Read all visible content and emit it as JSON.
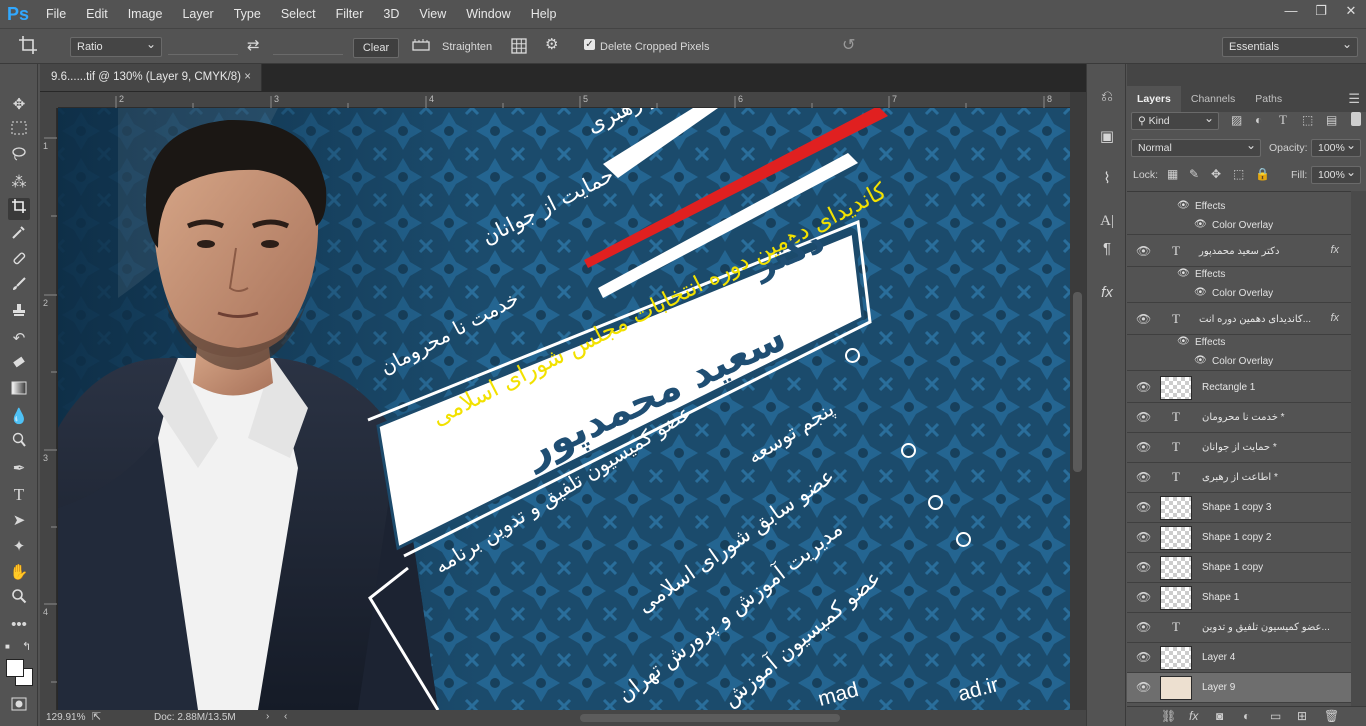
{
  "app": {
    "logo": "Ps"
  },
  "menu": [
    "File",
    "Edit",
    "Image",
    "Layer",
    "Type",
    "Select",
    "Filter",
    "3D",
    "View",
    "Window",
    "Help"
  ],
  "window_controls": {
    "minimize": "—",
    "restore": "❐",
    "close": "✕"
  },
  "options": {
    "ratio": "Ratio",
    "clear": "Clear",
    "straighten": "Straighten",
    "delete_cropped": "Delete Cropped Pixels",
    "workspace": "Essentials",
    "swap_icon": "⇄",
    "reset_icon": "↺"
  },
  "document": {
    "tab_title": "9.6......tif @ 130% (Layer 9, CMYK/8)",
    "close": "×",
    "ruler_h": [
      "2",
      "3",
      "4",
      "5",
      "6",
      "7",
      "8"
    ],
    "ruler_v": [
      "1",
      "2",
      "3",
      "4"
    ],
    "zoom": "129.91%",
    "doc_size": "Doc: 2.88M/13.5M"
  },
  "canvas_text": {
    "line1": "اطاعت از رهبری",
    "line2": "حمایت از جوانان",
    "line3": "خدمت نا محرومان",
    "candidate": "کاندیدای دهمین دوره انتخابات مجلس شورای اسلامی",
    "name_title": "دکتر",
    "name": "سعید محمدپور",
    "b1": "عضو کمیسیون تلفیق و تدوین برنامه",
    "b1b": "پنجم توسعه",
    "b2": "عضو سابق شورای اسلامی",
    "b3": "مدیریت آموزش و پرورش تهران",
    "b4": "عضو کمیسیون آموزش",
    "footer1": "mad",
    "footer2": "ad.ir"
  },
  "panel": {
    "tabs": [
      "Layers",
      "Channels",
      "Paths"
    ],
    "kind": "Kind",
    "blend": "Normal",
    "opacity_label": "Opacity:",
    "opacity": "100%",
    "lock_label": "Lock:",
    "fill_label": "Fill:",
    "fill": "100%"
  },
  "layers": [
    {
      "type": "sub",
      "label": "Effects"
    },
    {
      "type": "sub2",
      "label": "Color Overlay"
    },
    {
      "type": "text",
      "name": "دکتر سعید محمدپور",
      "fx": "fx"
    },
    {
      "type": "sub",
      "label": "Effects"
    },
    {
      "type": "sub2",
      "label": "Color Overlay"
    },
    {
      "type": "text",
      "name": "کاندیدای دهمین دوره انت...",
      "fx": "fx"
    },
    {
      "type": "sub",
      "label": "Effects"
    },
    {
      "type": "sub2",
      "label": "Color Overlay"
    },
    {
      "type": "raster",
      "name": "Rectangle 1"
    },
    {
      "type": "text",
      "name": "خدمت نا محرومان *"
    },
    {
      "type": "text",
      "name": "حمایت از جوانان *"
    },
    {
      "type": "text",
      "name": "اطاعت از رهبری *"
    },
    {
      "type": "shape",
      "name": "Shape 1 copy 3"
    },
    {
      "type": "shape",
      "name": "Shape 1 copy 2"
    },
    {
      "type": "shape",
      "name": "Shape 1 copy"
    },
    {
      "type": "shape",
      "name": "Shape 1"
    },
    {
      "type": "text",
      "name": "عضو کمیسیون تلفیق و تدوین..."
    },
    {
      "type": "raster",
      "name": "Layer 4"
    },
    {
      "type": "raster",
      "name": "Layer 9",
      "selected": true
    }
  ],
  "colors": {
    "accent": "#31a8ff",
    "canvas_bg": "#1c4a6b",
    "highlight_yellow": "#f2e100",
    "red_line": "#e02020"
  }
}
